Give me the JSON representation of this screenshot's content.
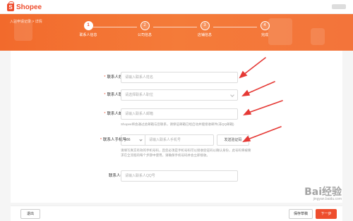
{
  "app": {
    "name": "Shopee",
    "logo_glyph": "S"
  },
  "breadcrumb": "入驻申请记录 > 详情",
  "steps": [
    {
      "number": "1",
      "label": "联系人信息",
      "active": true
    },
    {
      "number": "2",
      "label": "公司信息",
      "active": false
    },
    {
      "number": "3",
      "label": "店铺信息",
      "active": false
    },
    {
      "number": "4",
      "label": "完成",
      "active": false
    }
  ],
  "form": {
    "name": {
      "label": "联系人姓名",
      "required": "*",
      "placeholder": "请输入联系人姓名"
    },
    "position": {
      "label": "联系人职位",
      "required": "*",
      "placeholder": "请选择联系人职位"
    },
    "email": {
      "label": "联系人邮箱",
      "required": "*",
      "placeholder": "请输入联系人邮箱",
      "hint": "Shopee将会通过此邮箱与您联系，请保证邮箱已经启动并能接收邮件(非QQ邮箱)"
    },
    "phone": {
      "label": "联系人手机号",
      "required": "*",
      "prefix": "+86",
      "placeholder": "请输入联系人手机号",
      "code_button": "发送验证码",
      "hint": "请填写真实有效的手机号码，且您必须是手机号码可以接收验证码以确认身份，此号码将被要求在全流程的每个步骤中使用，请确保手机号码并会立即接收。"
    },
    "qq": {
      "label": "联系人QQ",
      "placeholder": "请输入联系人QQ号"
    }
  },
  "footer": {
    "exit": "退出",
    "save": "保存草稿",
    "next": "下一步"
  },
  "watermark": {
    "main": "Bai经验",
    "sub": "jingyan.baidu.com"
  },
  "colors": {
    "brand": "#ee4d2d",
    "annotation": "#e53935"
  }
}
